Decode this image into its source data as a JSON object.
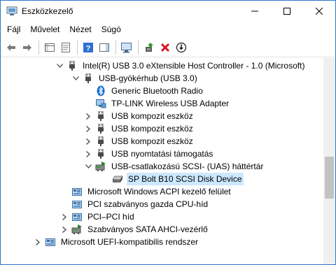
{
  "window": {
    "title": "Eszközkezelő"
  },
  "menu": {
    "items": [
      "Fájl",
      "Művelet",
      "Nézet",
      "Súgó"
    ]
  },
  "toolbar": {
    "buttons": [
      "back-arrow-icon",
      "forward-arrow-icon",
      "show-hide-console-tree-icon",
      "properties-icon",
      "help-icon",
      "action-pane-icon",
      "monitor-scan-icon",
      "update-driver-icon",
      "uninstall-icon",
      "disable-device-icon"
    ]
  },
  "tree": {
    "rows": [
      {
        "label": "Intel(R) USB 3.0 eXtensible Host Controller - 1.0 (Microsoft)",
        "expanded": true,
        "icon": "usb-icon"
      },
      {
        "label": "USB-gyökérhub (USB 3.0)",
        "expanded": true,
        "icon": "usb-icon"
      },
      {
        "label": "Generic Bluetooth Radio",
        "icon": "bluetooth-icon"
      },
      {
        "label": "TP-LINK Wireless USB Adapter",
        "icon": "network-icon"
      },
      {
        "label": "USB kompozit eszköz",
        "expanded": false,
        "icon": "usb-icon"
      },
      {
        "label": "USB kompozit eszköz",
        "expanded": false,
        "icon": "usb-icon"
      },
      {
        "label": "USB kompozit eszköz",
        "expanded": false,
        "icon": "usb-icon"
      },
      {
        "label": "USB nyomtatási támogatás",
        "expanded": false,
        "icon": "usb-icon"
      },
      {
        "label": "USB-csatlakozású SCSI- (UAS) háttértár",
        "expanded": true,
        "icon": "storage-controller-icon"
      },
      {
        "label": "SP Bolt B10 SCSI Disk Device",
        "selected": true,
        "icon": "disk-drive-icon"
      },
      {
        "label": "Microsoft Windows ACPI kezelő felület",
        "icon": "system-device-icon"
      },
      {
        "label": "PCI szabványos gazda CPU-híd",
        "icon": "system-device-icon"
      },
      {
        "label": "PCI–PCI híd",
        "expanded": false,
        "icon": "system-device-icon"
      },
      {
        "label": "Szabványos SATA AHCI-vezérlő",
        "expanded": false,
        "icon": "storage-controller-icon"
      },
      {
        "label": "Microsoft UEFI-kompatibilis rendszer",
        "expanded": false,
        "icon": "system-device-icon"
      }
    ]
  },
  "colors": {
    "selection": "#cce8ff",
    "window_border": "#2b79c9"
  }
}
